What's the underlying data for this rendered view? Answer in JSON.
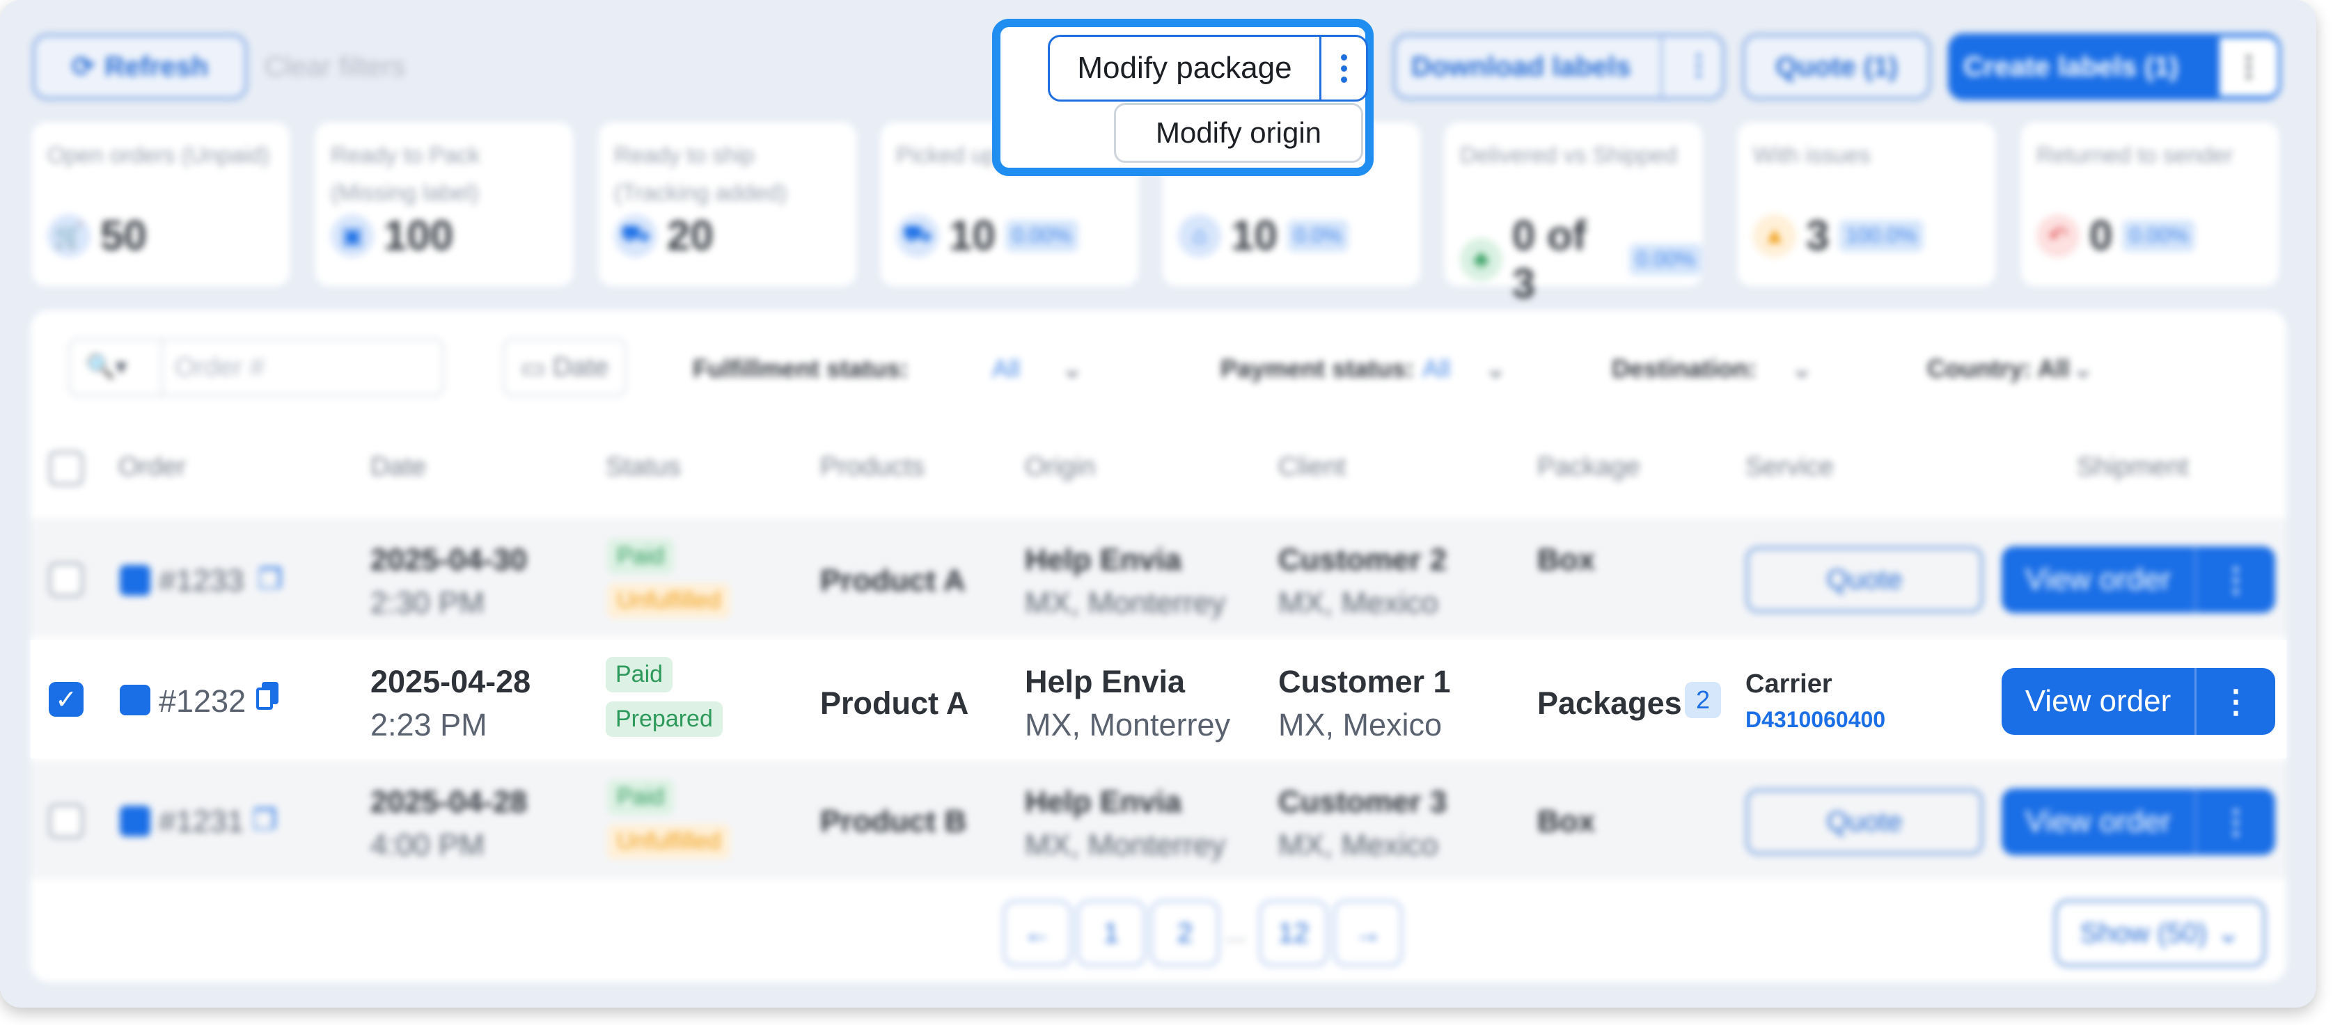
{
  "toolbar": {
    "refresh": "Refresh",
    "clear_filters": "Clear filters",
    "download_labels": "Download labels",
    "quote": "Quote (1)",
    "create_labels": "Create labels (1)"
  },
  "popup": {
    "modify_package": "Modify package",
    "modify_origin": "Modify origin"
  },
  "stats": [
    {
      "title": "Open orders (Unpaid)",
      "value": "50",
      "pct": "",
      "icon": "cart-icon"
    },
    {
      "title": "Ready to Pack (Missing label)",
      "value": "100",
      "pct": "",
      "icon": "box-icon"
    },
    {
      "title": "Ready to ship (Tracking added)",
      "value": "20",
      "pct": "",
      "icon": "truck-icon"
    },
    {
      "title": "Picked up / In transit",
      "value": "10",
      "pct": "0.00%",
      "icon": "truck-icon"
    },
    {
      "title": "",
      "value": "10",
      "pct": "0.0%",
      "icon": "home-icon"
    },
    {
      "title": "Delivered vs Shipped",
      "value": "0 of 3",
      "pct": "0.00%",
      "icon": "users-icon"
    },
    {
      "title": "With issues",
      "value": "3",
      "pct": "100.0%",
      "icon": "warning-icon"
    },
    {
      "title": "Returned to sender",
      "value": "0",
      "pct": "0.00%",
      "icon": "return-icon"
    }
  ],
  "filters": {
    "search_placeholder": "Order #",
    "date": "Date",
    "fulfillment_label": "Fulfillment status:",
    "fulfillment_value": "All",
    "payment_label": "Payment status:",
    "payment_value": "All",
    "destination_label": "Destination:",
    "country_label": "Country: All"
  },
  "table": {
    "headers": [
      "Order",
      "Date",
      "Status",
      "Products",
      "Origin",
      "Client",
      "Package",
      "Service",
      "Shipment"
    ],
    "rows": [
      {
        "order": "#1233",
        "date": "2025-04-30",
        "time": "2:30 PM",
        "status1": "Paid",
        "status2": "Unfulfilled",
        "product": "Product A",
        "origin": "Help Envia",
        "origin_loc": "MX, Monterrey",
        "client": "Customer 2",
        "client_loc": "MX, Mexico",
        "package": "Box",
        "service_btn": "Quote",
        "view": "View order"
      },
      {
        "order": "#1232",
        "date": "2025-04-28",
        "time": "2:23 PM",
        "status1": "Paid",
        "status2": "Prepared",
        "product": "Product A",
        "origin": "Help Envia",
        "origin_loc": "MX, Monterrey",
        "client": "Customer 1",
        "client_loc": "MX, Mexico",
        "package": "Packages",
        "package_count": "2",
        "carrier": "Carrier",
        "tracking": "D4310060400",
        "view": "View order"
      },
      {
        "order": "#1231",
        "date": "2025-04-28",
        "time": "4:00 PM",
        "status1": "Paid",
        "status2": "Unfulfilled",
        "product": "Product B",
        "origin": "Help Envia",
        "origin_loc": "MX, Monterrey",
        "client": "Customer 3",
        "client_loc": "MX, Mexico",
        "package": "Box",
        "service_btn": "Quote",
        "view": "View order"
      }
    ]
  },
  "pagination": {
    "prev": "←",
    "pages": [
      "1",
      "2",
      "12"
    ],
    "ellipsis": "...",
    "next": "→",
    "show": "Show (50)"
  }
}
